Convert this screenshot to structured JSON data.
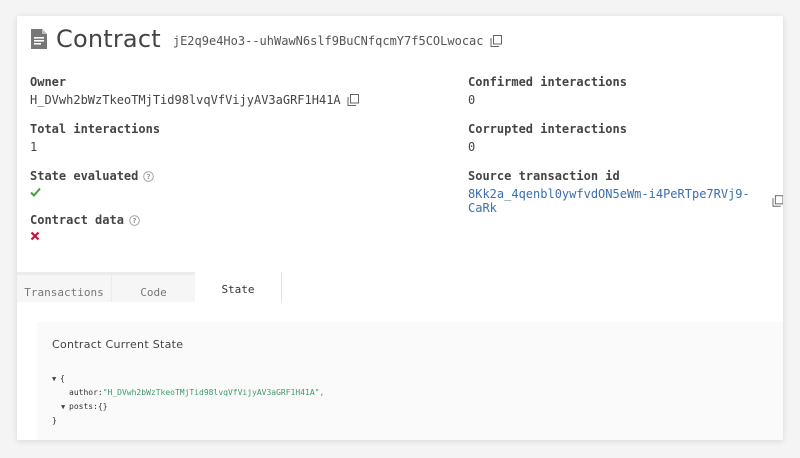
{
  "header": {
    "title": "Contract",
    "contract_id": "jE2q9e4Ho3--uhWawN6slf9BuCNfqcmY7f5COLwocac"
  },
  "fields": {
    "owner": {
      "label": "Owner",
      "value": "H_DVwh2bWzTkeoTMjTid98lvqVfVijyAV3aGRF1H41A"
    },
    "confirmed": {
      "label": "Confirmed interactions",
      "value": "0"
    },
    "total": {
      "label": "Total interactions",
      "value": "1"
    },
    "corrupted": {
      "label": "Corrupted interactions",
      "value": "0"
    },
    "state_evaluated": {
      "label": "State evaluated",
      "status": "check"
    },
    "source_tx": {
      "label": "Source transaction id",
      "value": "8Kk2a_4qenbl0ywfvdON5eWm-i4PeRTpe7RVj9-CaRk"
    },
    "contract_data": {
      "label": "Contract data",
      "status": "cross"
    }
  },
  "tabs": [
    {
      "label": "Transactions"
    },
    {
      "label": "Code"
    },
    {
      "label": "State"
    }
  ],
  "state": {
    "title": "Contract Current State",
    "open_brace": "{",
    "author_key": "author:",
    "author_value": "\"H_DVwh2bWzTkeoTMjTid98lvqVfVijyAV3aGRF1H41A\",",
    "posts_key": "posts:",
    "posts_value": "{}",
    "close_brace": "}"
  },
  "colors": {
    "success": "#3aa63a",
    "error": "#d0103a",
    "link": "#3a6fb0",
    "string": "#3e9a6a"
  },
  "icons": {
    "header": "document-icon",
    "copy": "copy-icon",
    "help": "help-circle-icon",
    "check": "check-icon",
    "cross": "cross-icon",
    "expand": "triangle-down-icon"
  }
}
